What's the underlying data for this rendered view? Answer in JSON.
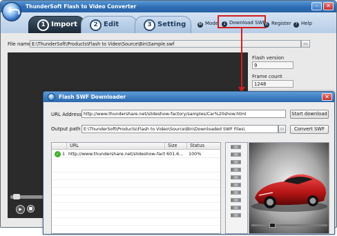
{
  "app": {
    "title": "ThunderSoft Flash to Video Converter",
    "window_buttons": {
      "minimize": "–",
      "close": "✕"
    }
  },
  "tabs": [
    {
      "num": "1",
      "label": "Import",
      "active": true
    },
    {
      "num": "2",
      "label": "Edit",
      "active": false
    },
    {
      "num": "3",
      "label": "Setting",
      "active": false
    }
  ],
  "toolbar": {
    "mode": "Mode",
    "download_swf": "Download SWF",
    "register": "Register",
    "help": "Help"
  },
  "file": {
    "label": "File name",
    "value": "E:\\ThunderSoft\\Products\\Flash to Video\\Source\\Bin\\Sample.swf"
  },
  "info": {
    "flash_version_label": "Flash version",
    "flash_version": "9",
    "frame_count_label": "Frame count",
    "frame_count": "1248"
  },
  "downloader": {
    "title": "Flash SWF Downloader",
    "url_label": "URL Address",
    "url_value": "http://www.thundershare.net/slideshow-factory/samples/Car%20show.html",
    "start_button": "Start download",
    "output_label": "Output path",
    "output_value": "E:\\ThunderSoft\\Products\\Flash to Video\\Source\\Bin\\Downloaded SWF Files\\",
    "convert_button": "Convert SWF",
    "table": {
      "columns": [
        "",
        "URL",
        "Size",
        "Status"
      ],
      "rows": [
        {
          "num": "1",
          "url": "http://www.thundershare.net/slideshow-factor...",
          "size": "601.6...",
          "status": "100%"
        }
      ]
    }
  },
  "colors": {
    "accent": "#2d6db4",
    "highlight": "#d31c1c",
    "preview_bg": "#2b2b2b"
  }
}
